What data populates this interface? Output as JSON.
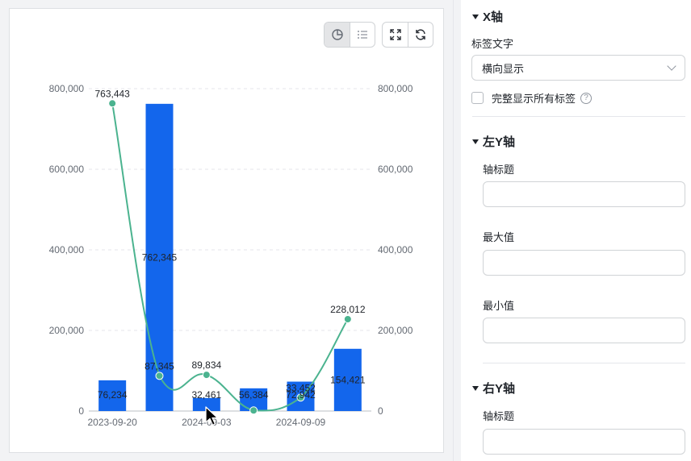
{
  "chart_data": {
    "type": "bar+line",
    "categories": [
      "2023-09-20",
      "",
      "2024-09-03",
      "",
      "2024-09-09",
      ""
    ],
    "x_tick_labels": [
      "2023-09-20",
      "2024-09-03",
      "2024-09-09"
    ],
    "series": [
      {
        "type": "bar",
        "axis": "left",
        "color": "#1366ec",
        "values": [
          76234,
          762345,
          32461,
          56384,
          72942,
          154421
        ]
      },
      {
        "type": "line",
        "axis": "right",
        "smooth": true,
        "color": "#4bb38f",
        "values": [
          763443,
          87345,
          89834,
          1500,
          33452,
          228012
        ]
      }
    ],
    "left_axis": {
      "ticks": [
        "0",
        "200,000",
        "400,000",
        "600,000",
        "800,000"
      ],
      "ylim": [
        0,
        800000
      ]
    },
    "right_axis": {
      "ticks": [
        "0",
        "200,000",
        "400,000",
        "600,000",
        "800,000"
      ],
      "ylim": [
        0,
        800000
      ]
    },
    "bar_labels": [
      "76,234",
      "762,345",
      "32,461",
      "56,384",
      "72,942",
      "154,421"
    ],
    "line_labels": [
      "763,443",
      "87,345",
      "89,834",
      "",
      "33,452",
      "228,012"
    ],
    "grid": "dashed-horizontal"
  },
  "toolbar": {
    "icons": [
      "pie-chart-icon",
      "list-icon",
      "fullscreen-icon",
      "refresh-icon"
    ]
  },
  "settings": {
    "x_axis": {
      "title": "X轴",
      "label_text_label": "标签文字",
      "label_text_value": "横向显示",
      "show_all_labels": "完整显示所有标签",
      "help": "?"
    },
    "left_y_axis": {
      "title": "左Y轴",
      "axis_title_label": "轴标题",
      "max_label": "最大值",
      "min_label": "最小值"
    },
    "right_y_axis": {
      "title": "右Y轴",
      "axis_title_label": "轴标题"
    }
  },
  "colors": {
    "bar": "#1366ec",
    "line": "#4bb38f",
    "grid": "#e5e6eb"
  }
}
